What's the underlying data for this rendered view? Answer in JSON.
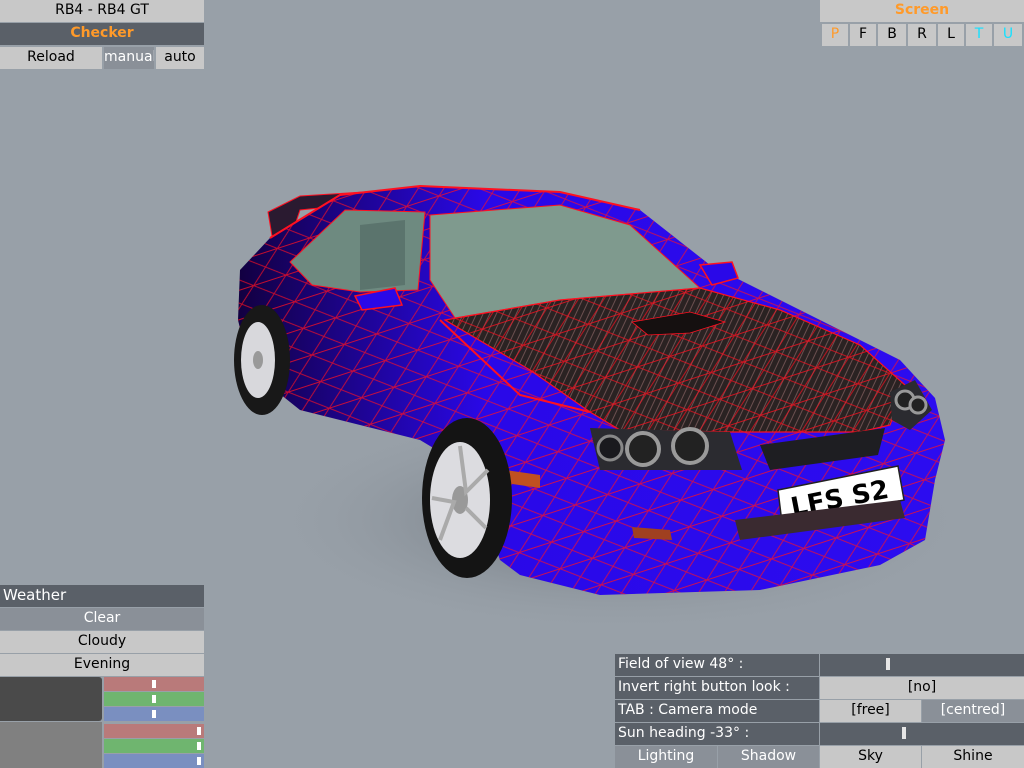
{
  "top_left": {
    "car_name": "RB4 - RB4 GT",
    "skin_label": "Checker",
    "reload_label": "Reload",
    "manual_label": "manual",
    "auto_label": "auto"
  },
  "screen_panel": {
    "title": "Screen",
    "views": [
      "P",
      "F",
      "B",
      "R",
      "L",
      "T",
      "U"
    ]
  },
  "weather": {
    "title": "Weather",
    "options": [
      "Clear",
      "Cloudy",
      "Evening"
    ],
    "sliders": [
      {
        "color": "#b97a7a",
        "level": 0.5
      },
      {
        "color": "#6fb56f",
        "level": 0.5
      },
      {
        "color": "#7a8fc0",
        "level": 0.5
      },
      {
        "color": "#b97a7a",
        "level": 0.97
      },
      {
        "color": "#6fb56f",
        "level": 0.97
      },
      {
        "color": "#7a8fc0",
        "level": 0.97
      }
    ]
  },
  "camera_settings": {
    "fov_label": "Field of view 48° :",
    "fov_level": 0.33,
    "invert_label": "Invert right button look :",
    "invert_value": "[no]",
    "camera_mode_label": "TAB : Camera mode",
    "camera_mode_free": "[free]",
    "camera_mode_centred": "[centred]",
    "sun_label": "Sun heading -33° :",
    "sun_level": 0.41,
    "tabs": [
      "Lighting",
      "Shadow",
      "Sky",
      "Shine"
    ]
  },
  "viewport": {
    "plate_text": "LFS S2",
    "body_color": "#2a08e8",
    "wire_color": "#ff1020"
  }
}
